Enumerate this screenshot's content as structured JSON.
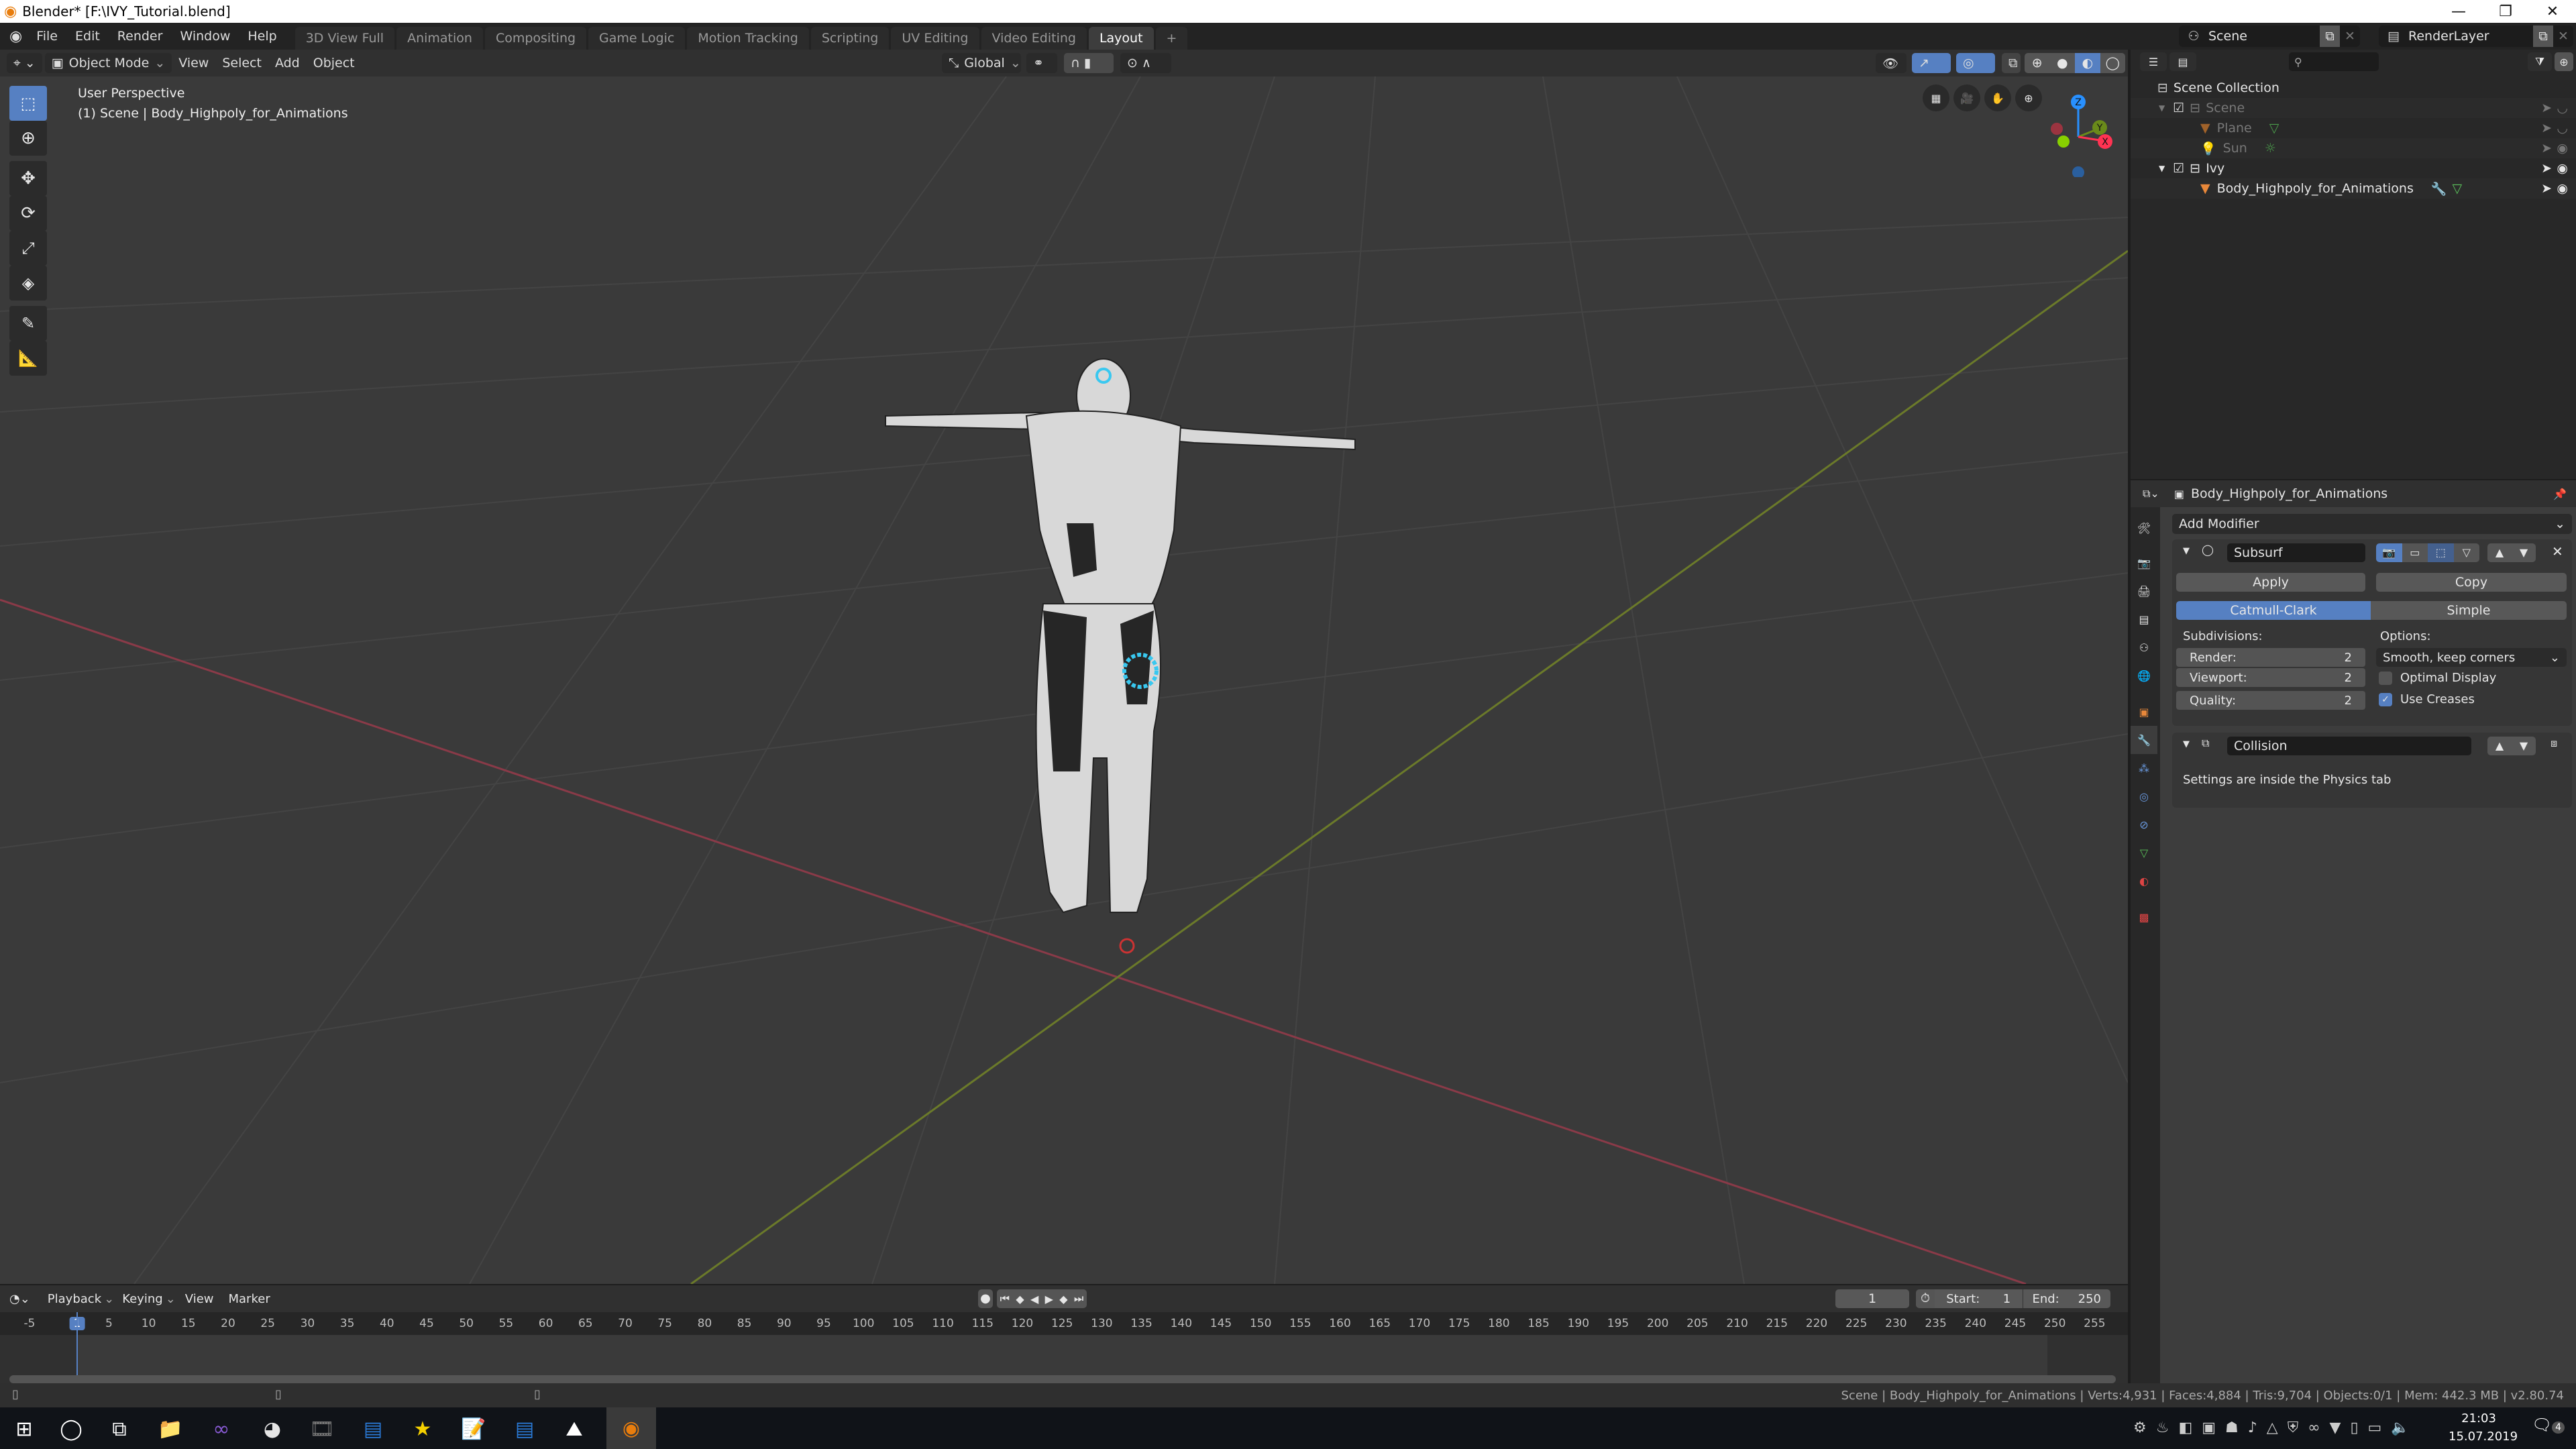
{
  "window": {
    "title": "Blender* [F:\\IVY_Tutorial.blend]",
    "controls": [
      "minimize",
      "restore",
      "close"
    ]
  },
  "topbar": {
    "menus": [
      "File",
      "Edit",
      "Render",
      "Window",
      "Help"
    ],
    "workspaces": [
      "3D View Full",
      "Animation",
      "Compositing",
      "Game Logic",
      "Motion Tracking",
      "Scripting",
      "UV Editing",
      "Video Editing",
      "Layout"
    ],
    "active_workspace": "Layout",
    "add_workspace": "+",
    "scene": "Scene",
    "view_layer": "RenderLayer"
  },
  "viewport_header": {
    "mode": "Object Mode",
    "menus": [
      "View",
      "Select",
      "Add",
      "Object"
    ],
    "transform_orientation": "Global",
    "shading_modes": [
      "wireframe",
      "solid",
      "material-preview",
      "rendered"
    ],
    "active_shading": "material-preview"
  },
  "viewport": {
    "view_name": "User Perspective",
    "scene_info": "(1) Scene | Body_Highpoly_for_Animations",
    "tools": [
      "select-box",
      "cursor",
      "move",
      "rotate",
      "scale",
      "transform",
      "annotate",
      "measure"
    ],
    "active_tool": "select-box",
    "nav_buttons": [
      "toggle-grid",
      "camera-view",
      "pan",
      "zoom"
    ],
    "gizmo_axes": [
      "X",
      "Y",
      "Z"
    ],
    "axis_colors": {
      "x": "#ff3352",
      "y": "#8bdc00",
      "z": "#2890ff"
    }
  },
  "outliner": {
    "search_placeholder": "",
    "root": "Scene Collection",
    "items": [
      {
        "label": "Scene",
        "level": 0,
        "type": "collection",
        "checked": true,
        "dim": true,
        "expanded": true
      },
      {
        "label": "Plane",
        "level": 1,
        "type": "mesh",
        "dim": true
      },
      {
        "label": "Sun",
        "level": 1,
        "type": "light",
        "dim": true
      },
      {
        "label": "Ivy",
        "level": 0,
        "type": "collection",
        "checked": true,
        "dim": false,
        "expanded": true
      },
      {
        "label": "Body_Highpoly_for_Animations",
        "level": 1,
        "type": "mesh",
        "dim": false,
        "has_modifier": true
      }
    ]
  },
  "properties": {
    "object_name": "Body_Highpoly_for_Animations",
    "add_modifier": "Add Modifier",
    "subsurf": {
      "name": "Subsurf",
      "apply": "Apply",
      "copy": "Copy",
      "types": [
        "Catmull-Clark",
        "Simple"
      ],
      "active_type": "Catmull-Clark",
      "subdivisions_label": "Subdivisions:",
      "render_label": "Render:",
      "render_value": "2",
      "viewport_label": "Viewport:",
      "viewport_value": "2",
      "quality_label": "Quality:",
      "quality_value": "2",
      "options_label": "Options:",
      "uv_smooth": "Smooth, keep corners",
      "optimal_display_label": "Optimal Display",
      "optimal_display": false,
      "use_creases_label": "Use Creases",
      "use_creases": true
    },
    "collision": {
      "name": "Collision",
      "info": "Settings are inside the Physics tab"
    }
  },
  "timeline": {
    "menus": [
      "Playback",
      "Keying",
      "View",
      "Marker"
    ],
    "current_frame": "1",
    "start_label": "Start:",
    "start": "1",
    "end_label": "End:",
    "end": "250",
    "ticks": [
      "-5",
      "1",
      "5",
      "10",
      "15",
      "20",
      "25",
      "30",
      "35",
      "40",
      "45",
      "50",
      "55",
      "60",
      "65",
      "70",
      "75",
      "80",
      "85",
      "90",
      "95",
      "100",
      "105",
      "110",
      "115",
      "120",
      "125",
      "130",
      "135",
      "140",
      "145",
      "150",
      "155",
      "160",
      "165",
      "170",
      "175",
      "180",
      "185",
      "190",
      "195",
      "200",
      "205",
      "210",
      "215",
      "220",
      "225",
      "230",
      "235",
      "240",
      "245",
      "250",
      "255"
    ]
  },
  "statusbar": {
    "info": "Scene | Body_Highpoly_for_Animations | Verts:4,931 | Faces:4,884 | Tris:9,704 | Objects:0/1 | Mem: 442.3 MB | v2.80.74"
  },
  "taskbar": {
    "apps": [
      "start",
      "search",
      "task-view",
      "file-explorer",
      "visual-studio",
      "chrome",
      "media",
      "app-window",
      "favorites",
      "notepad",
      "app-window-2",
      "photos",
      "blender"
    ],
    "time": "21:03",
    "date": "15.07.2019",
    "notifications": "4"
  }
}
